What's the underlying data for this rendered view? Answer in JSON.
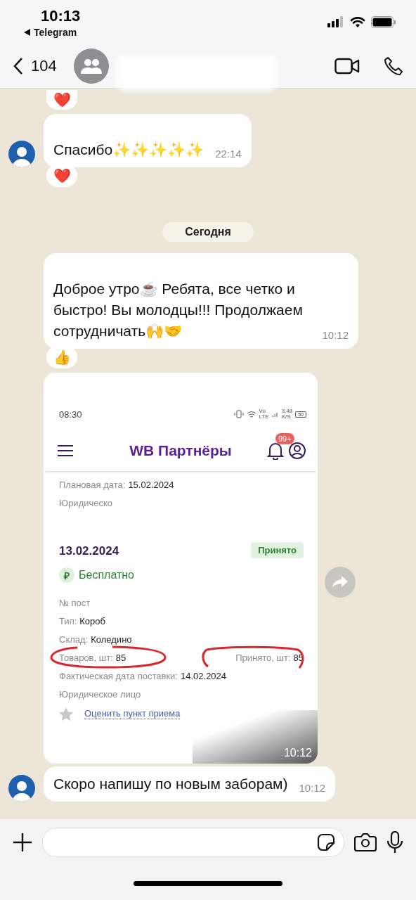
{
  "status_bar": {
    "time": "10:13",
    "back_app": "Telegram"
  },
  "header": {
    "back_count": "104"
  },
  "chat": [
    {
      "kind": "reaction",
      "emoji": "❤️",
      "top": true
    },
    {
      "kind": "text",
      "text": "Спасибо✨✨✨✨✨",
      "time": "22:14",
      "avatar": true
    },
    {
      "kind": "reaction",
      "emoji": "❤️",
      "top": false
    },
    {
      "kind": "date",
      "text": "Сегодня"
    },
    {
      "kind": "text",
      "text": "Доброе утро☕ Ребята, все четко и быстро! Вы молодцы!!! Продолжаем сотрудничать🙌🤝",
      "time": "10:12",
      "avatar": false
    },
    {
      "kind": "reaction",
      "emoji": "👍",
      "top": false
    },
    {
      "kind": "image",
      "time": "10:12",
      "avatar": false
    },
    {
      "kind": "text",
      "text": "Скоро напишу по новым заборам)",
      "time": "10:12",
      "avatar": true
    }
  ],
  "screenshot": {
    "time": "08:30",
    "network": [
      "Vo",
      "LTE"
    ],
    "speed": [
      "3,48",
      "K/S"
    ],
    "battery": "50",
    "app_title": "WB Партнёры",
    "badge": "99+",
    "top_rows": [
      {
        "label": "Плановая дата:",
        "value": "15.02.2024"
      },
      {
        "label": "Юридическо"
      }
    ],
    "date": "13.02.2024",
    "status": "Принято",
    "currency": "₽",
    "price": "Бесплатно",
    "details": [
      {
        "label": "№ пост"
      },
      {
        "label": "Тип:",
        "value": "Короб"
      },
      {
        "label": "Склад:",
        "value": "Коледино"
      },
      {
        "label": "Товаров, шт:",
        "value": "85",
        "right_label": "Принято, шт:",
        "right_value": "85"
      },
      {
        "label": "Фактическая дата поставки:",
        "value": "14.02.2024"
      },
      {
        "label": "Юридическое лицо"
      }
    ],
    "link": "Оценить пункт приема"
  }
}
